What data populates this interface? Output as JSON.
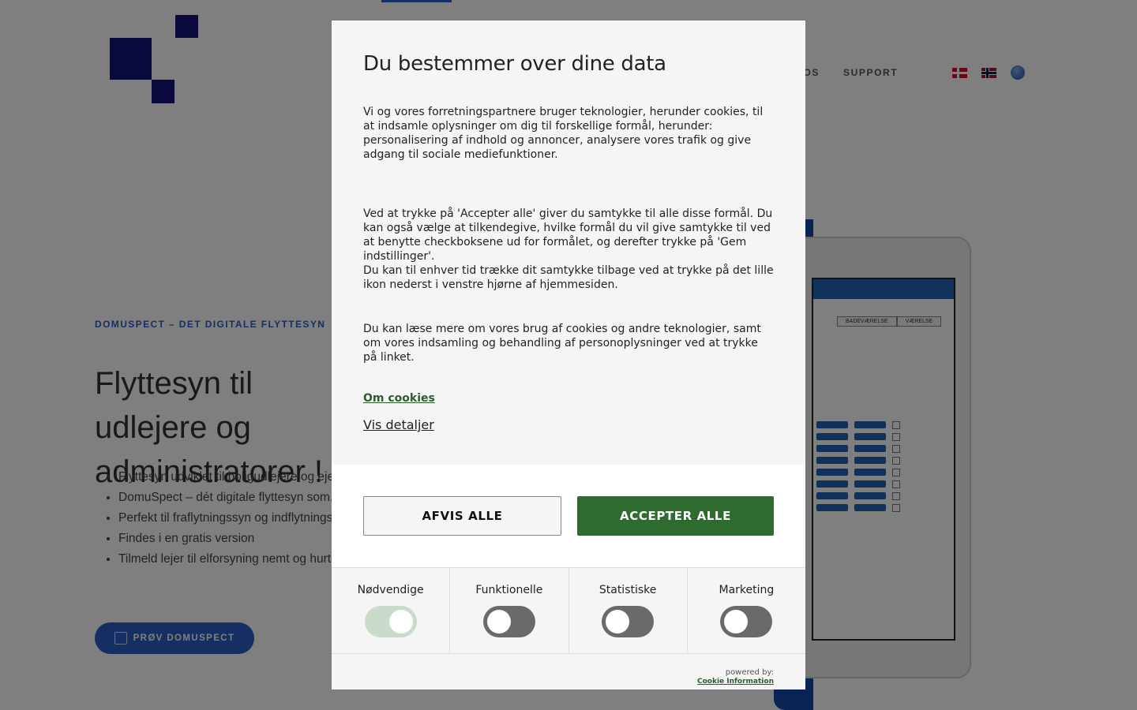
{
  "page": {
    "nav": [
      "OM OS",
      "SUPPORT"
    ],
    "eyebrow": "DOMUSPECT – DET DIGITALE FLYTTESYN",
    "hero_title": "Flyttesyn til udlejere og administratorer !",
    "bullets": [
      "Flyttesyn udviklet til boligudlejere og ejendomsadministratorer",
      "DomuSpect – dét digitale flyttesyn som...",
      "Perfekt til fraflytningssyn og indflytningssyn",
      "Findes i en gratis version",
      "Tilmeld lejer til elforsyning nemt og hurtigt"
    ],
    "cta_label": "PRØV DOMUSPECT",
    "tablet_headers": [
      "BADEVÆRELSE",
      "VÆRELSE"
    ]
  },
  "modal": {
    "title": "Du bestemmer over dine data",
    "paragraph_1": "Vi og vores forretningspartnere bruger teknologier, herunder cookies, til at indsamle oplysninger om dig til forskellige formål, herunder: personalisering af indhold og annoncer, analysere vores trafik og give adgang til sociale mediefunktioner.",
    "paragraph_2a": "Ved at trykke på 'Accepter alle' giver du samtykke til alle disse formål. Du kan også vælge at tilkendegive, hvilke formål du vil give samtykke til ved at benytte checkboksene ud for formålet, og derefter trykke på 'Gem indstillinger'.",
    "paragraph_2b": "Du kan til enhver tid trække dit samtykke tilbage ved at trykke på det lille ikon nederst i venstre hjørne af hjemmesiden.",
    "paragraph_3": "Du kan læse mere om vores brug af cookies og andre teknologier, samt om vores indsamling og behandling af personoplysninger ved at trykke på linket.",
    "link_cookies": "Om cookies",
    "link_details": "Vis detaljer",
    "reject_label": "AFVIS ALLE",
    "accept_label": "ACCEPTER ALLE",
    "toggles": [
      {
        "label": "Nødvendige",
        "on": true
      },
      {
        "label": "Funktionelle",
        "on": false
      },
      {
        "label": "Statistiske",
        "on": false
      },
      {
        "label": "Marketing",
        "on": false
      }
    ],
    "powered_by": "powered by:",
    "powered_link": "Cookie Information"
  },
  "colors": {
    "accent_blue": "#2a5fc7",
    "logo_navy": "#12127a",
    "accept_green": "#2e6b2e"
  }
}
